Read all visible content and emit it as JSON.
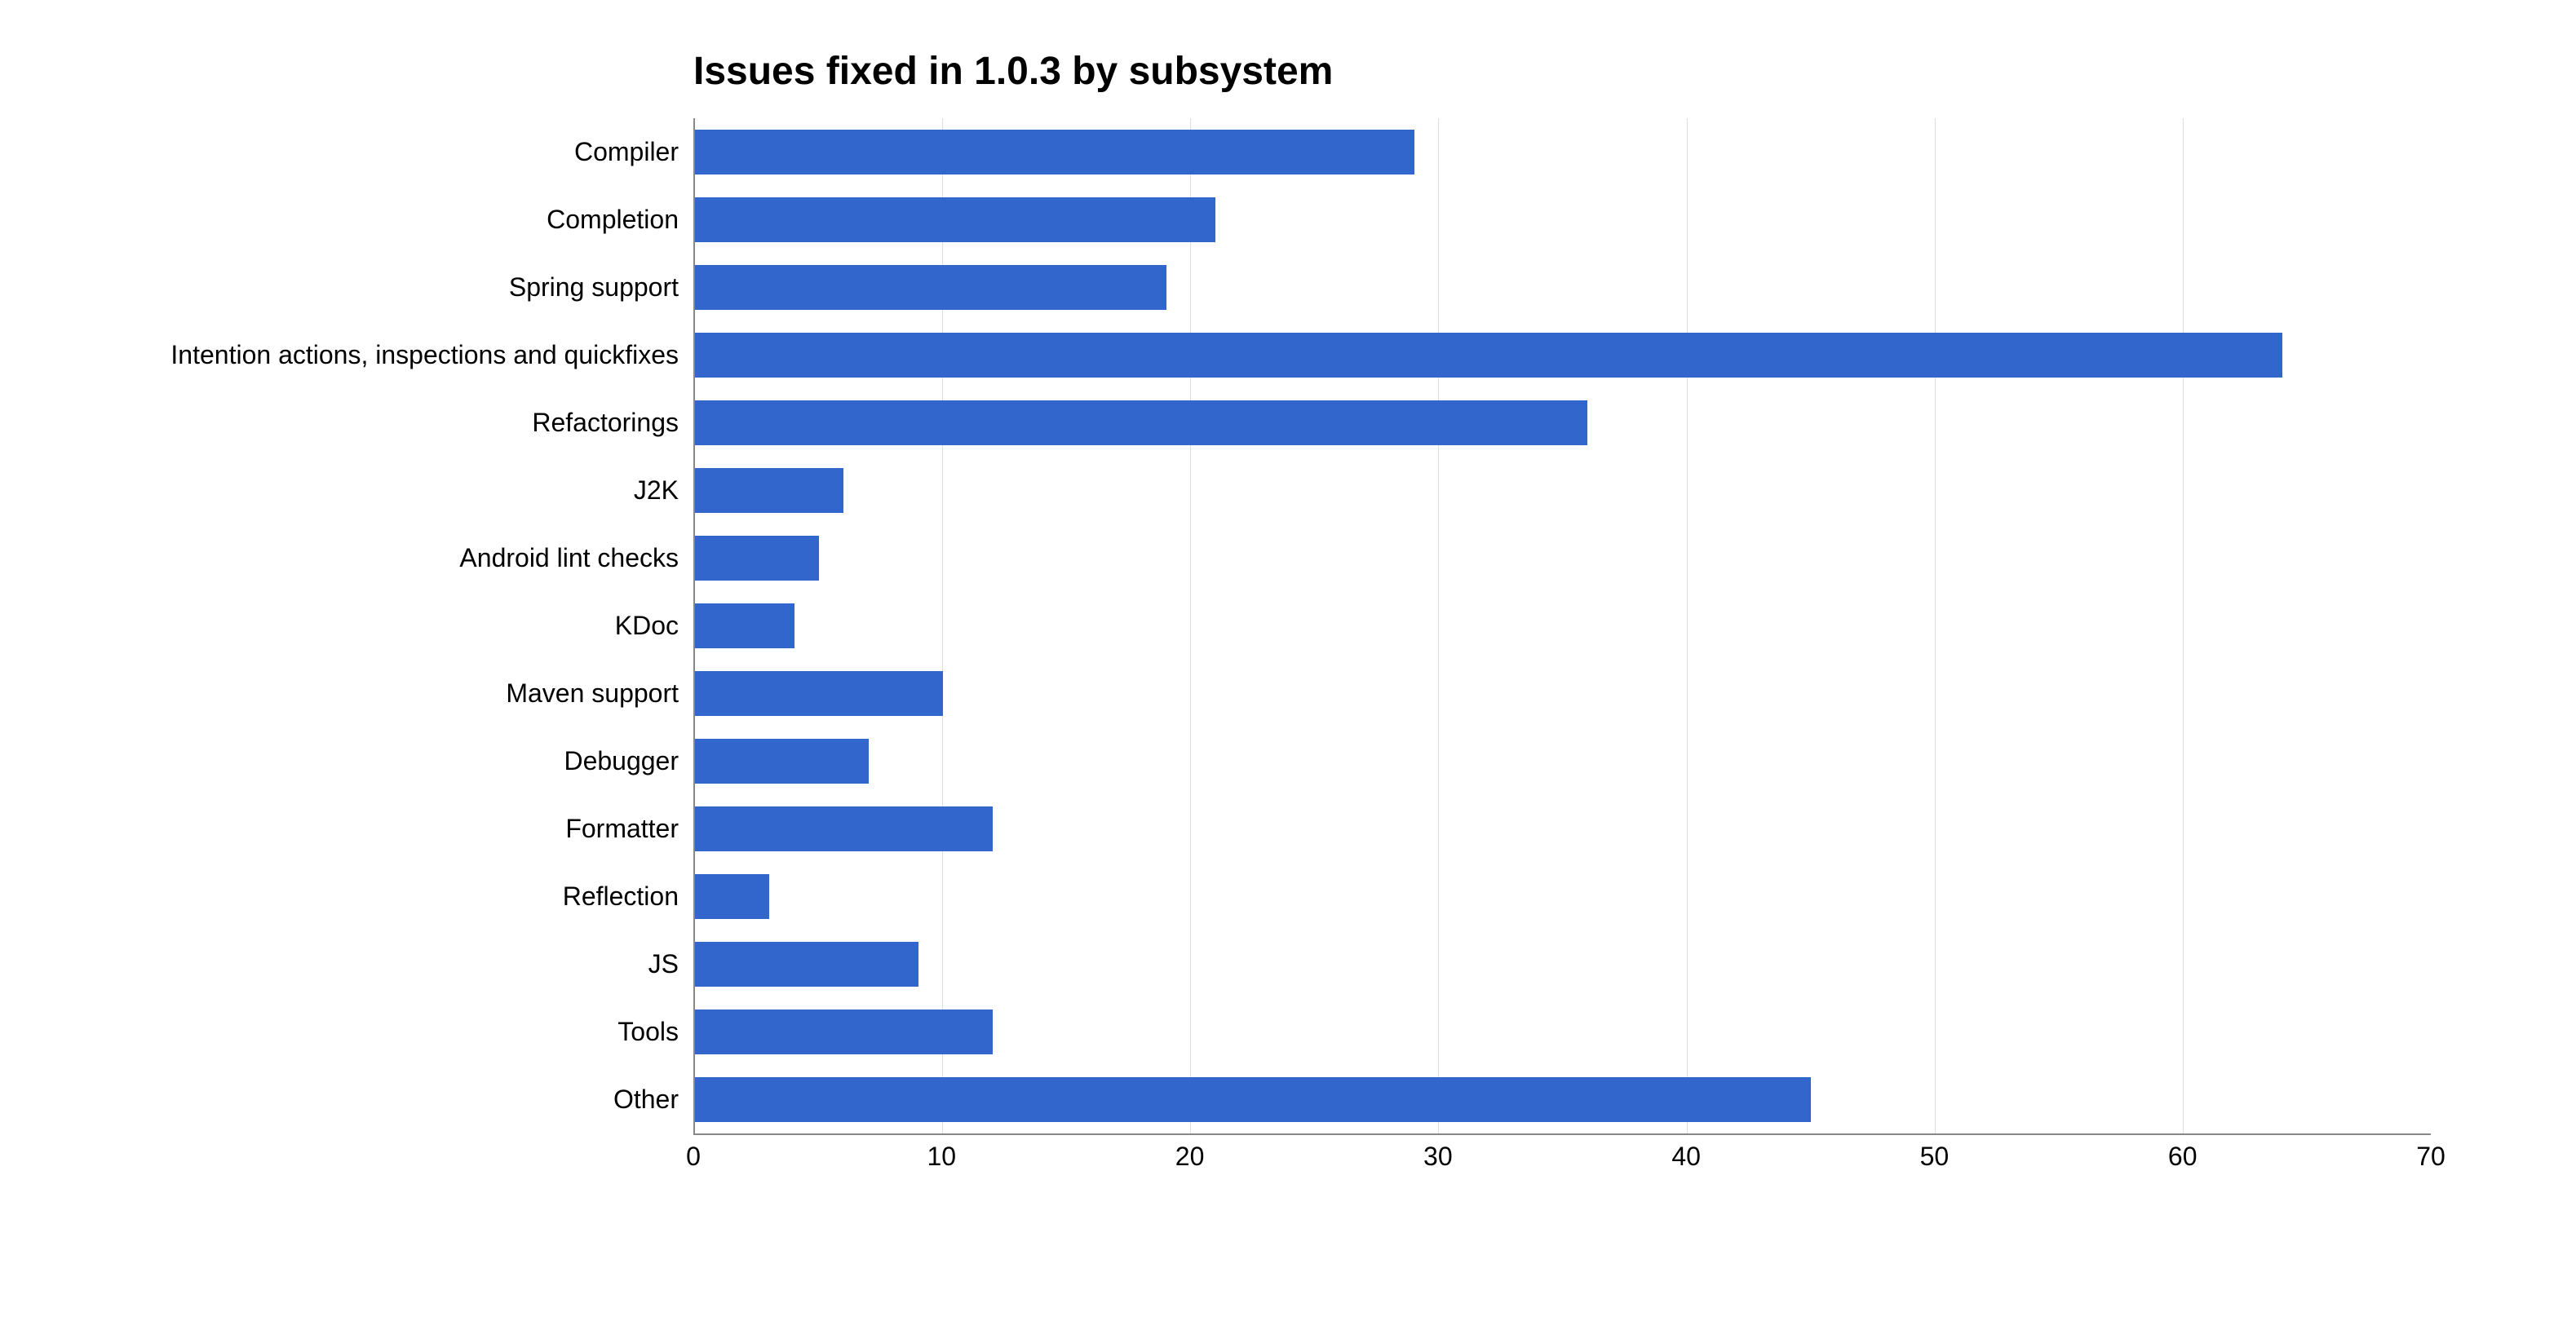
{
  "chart_data": {
    "type": "bar",
    "orientation": "horizontal",
    "title": "Issues fixed in 1.0.3 by subsystem",
    "categories": [
      "Compiler",
      "Completion",
      "Spring support",
      "Intention actions, inspections and quickfixes",
      "Refactorings",
      "J2K",
      "Android lint checks",
      "KDoc",
      "Maven support",
      "Debugger",
      "Formatter",
      "Reflection",
      "JS",
      "Tools",
      "Other"
    ],
    "values": [
      29,
      21,
      19,
      64,
      36,
      6,
      5,
      4,
      10,
      7,
      12,
      3,
      9,
      12,
      45
    ],
    "xlabel": "",
    "ylabel": "",
    "xlim": [
      0,
      70
    ],
    "x_ticks": [
      0,
      10,
      20,
      30,
      40,
      50,
      60,
      70
    ],
    "bar_color": "#3366cc",
    "grid": true
  }
}
